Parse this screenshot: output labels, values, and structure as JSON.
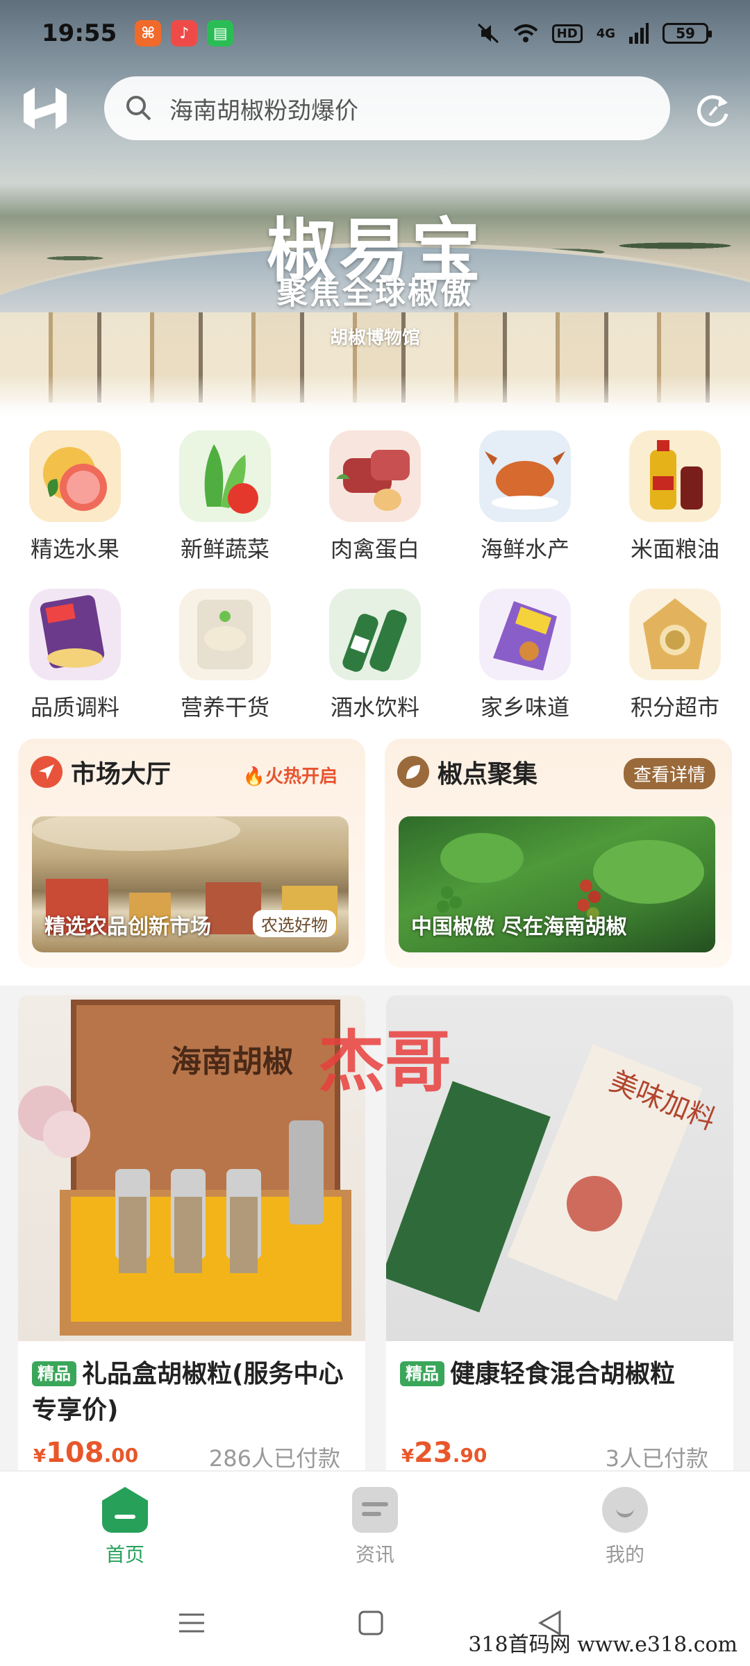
{
  "status_bar": {
    "time": "19:55",
    "notifications": [
      {
        "name": "app-notification-icon",
        "color": "#f06a2b",
        "glyph": "⌘"
      },
      {
        "name": "music-notification-icon",
        "color": "#ee4b48",
        "glyph": "♪"
      },
      {
        "name": "message-notification-icon",
        "color": "#2bbd55",
        "glyph": "▤"
      }
    ],
    "network": "4G",
    "hd_label": "HD",
    "battery": "59"
  },
  "header": {
    "search_placeholder": "海南胡椒粉劲爆价",
    "brand_title": "椒易宝",
    "brand_subtitle": "聚焦全球椒傲",
    "museum_sign": "胡椒博物馆"
  },
  "categories": [
    {
      "label": "精选水果",
      "icon": "fruit-icon",
      "color": "#f5b83d"
    },
    {
      "label": "新鲜蔬菜",
      "icon": "vegetable-icon",
      "color": "#4fae3f"
    },
    {
      "label": "肉禽蛋白",
      "icon": "meat-icon",
      "color": "#b03a3a"
    },
    {
      "label": "海鲜水产",
      "icon": "seafood-icon",
      "color": "#d66a2f"
    },
    {
      "label": "米面粮油",
      "icon": "grain-oil-icon",
      "color": "#e6b21a"
    },
    {
      "label": "品质调料",
      "icon": "seasoning-icon",
      "color": "#6b3a8a"
    },
    {
      "label": "营养干货",
      "icon": "dried-goods-icon",
      "color": "#e7dfcf"
    },
    {
      "label": "酒水饮料",
      "icon": "drinks-icon",
      "color": "#2f7a3e"
    },
    {
      "label": "家乡味道",
      "icon": "hometown-food-icon",
      "color": "#8a5ec9"
    },
    {
      "label": "积分超市",
      "icon": "points-market-icon",
      "color": "#e2b35c"
    }
  ],
  "features": {
    "market": {
      "title": "市场大厅",
      "tag": "火热开启",
      "caption": "精选农品创新市场",
      "button": "农选好物"
    },
    "pepper": {
      "title": "椒点聚集",
      "tag": "查看详情",
      "caption": "中国椒傲  尽在海南胡椒"
    }
  },
  "products": [
    {
      "badge": "精品",
      "title": "礼品盒胡椒粒(服务中心专享价)",
      "currency": "¥",
      "price_int": "108",
      "price_dec": ".00",
      "sold": "286人已付款"
    },
    {
      "badge": "精品",
      "title": "健康轻食混合胡椒粒",
      "currency": "¥",
      "price_int": "23",
      "price_dec": ".90",
      "sold": "3人已付款"
    }
  ],
  "watermark": "杰哥",
  "tabbar": [
    {
      "label": "首页",
      "active": true
    },
    {
      "label": "资讯",
      "active": false
    },
    {
      "label": "我的",
      "active": false
    }
  ],
  "site_watermark": "318首码网  www.e318.com",
  "colors": {
    "accent": "#27a05a",
    "price": "#e8572a",
    "hot": "#e8532f"
  }
}
